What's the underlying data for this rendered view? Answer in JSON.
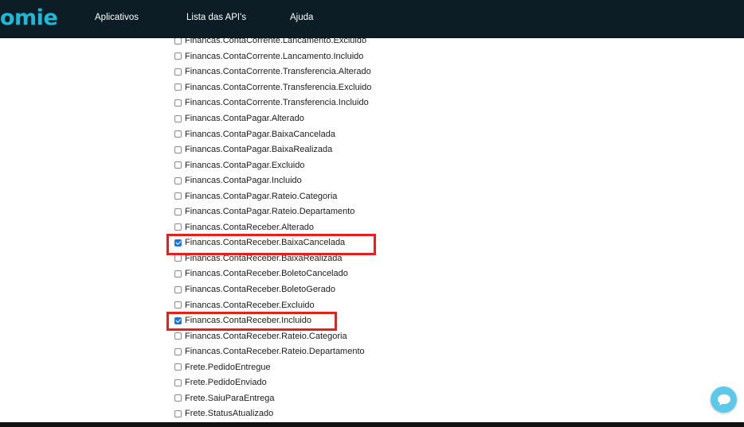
{
  "brand": {
    "logo_text": "omie",
    "color": "#1fb9d6"
  },
  "nav": {
    "items": [
      {
        "label": "Aplicativos"
      },
      {
        "label": "Lista das API's"
      },
      {
        "label": "Ajuda"
      }
    ]
  },
  "events": [
    {
      "label": "Financas.ContaCorrente.Lancamento.Excluido",
      "checked": false
    },
    {
      "label": "Financas.ContaCorrente.Lancamento.Incluido",
      "checked": false
    },
    {
      "label": "Financas.ContaCorrente.Transferencia.Alterado",
      "checked": false
    },
    {
      "label": "Financas.ContaCorrente.Transferencia.Excluido",
      "checked": false
    },
    {
      "label": "Financas.ContaCorrente.Transferencia.Incluido",
      "checked": false
    },
    {
      "label": "Financas.ContaPagar.Alterado",
      "checked": false
    },
    {
      "label": "Financas.ContaPagar.BaixaCancelada",
      "checked": false
    },
    {
      "label": "Financas.ContaPagar.BaixaRealizada",
      "checked": false
    },
    {
      "label": "Financas.ContaPagar.Excluido",
      "checked": false
    },
    {
      "label": "Financas.ContaPagar.Incluido",
      "checked": false
    },
    {
      "label": "Financas.ContaPagar.Rateio.Categoria",
      "checked": false
    },
    {
      "label": "Financas.ContaPagar.Rateio.Departamento",
      "checked": false
    },
    {
      "label": "Financas.ContaReceber.Alterado",
      "checked": false
    },
    {
      "label": "Financas.ContaReceber.BaixaCancelada",
      "checked": true,
      "highlighted": true
    },
    {
      "label": "Financas.ContaReceber.BaixaRealizada",
      "checked": false
    },
    {
      "label": "Financas.ContaReceber.BoletoCancelado",
      "checked": false
    },
    {
      "label": "Financas.ContaReceber.BoletoGerado",
      "checked": false
    },
    {
      "label": "Financas.ContaReceber.Excluido",
      "checked": false
    },
    {
      "label": "Financas.ContaReceber.Incluido",
      "checked": true,
      "highlighted": true
    },
    {
      "label": "Financas.ContaReceber.Rateio.Categoria",
      "checked": false
    },
    {
      "label": "Financas.ContaReceber.Rateio.Departamento",
      "checked": false
    },
    {
      "label": "Frete.PedidoEntregue",
      "checked": false
    },
    {
      "label": "Frete.PedidoEnviado",
      "checked": false
    },
    {
      "label": "Frete.SaiuParaEntrega",
      "checked": false
    },
    {
      "label": "Frete.StatusAtualizado",
      "checked": false
    }
  ],
  "colors": {
    "topbar": "#0c1d26",
    "highlight": "#e2231a",
    "checkbox_checked": "#1a73e8",
    "chat_button": "#5dc9ea"
  },
  "chat": {
    "icon": "chat-bubble-icon"
  }
}
